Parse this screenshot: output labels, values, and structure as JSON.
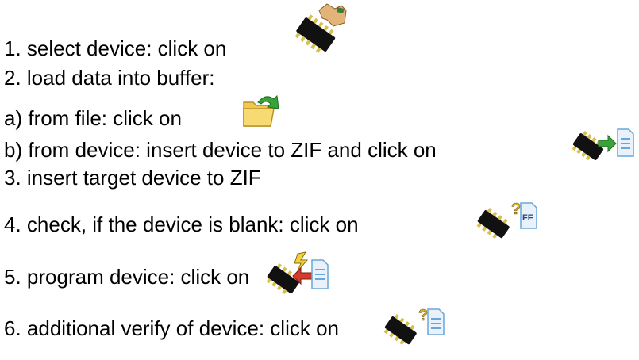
{
  "steps": [
    {
      "text": "1.  select device: click on",
      "icon": "select-device-icon"
    },
    {
      "text": "2.  load data into buffer:"
    },
    {
      "text": "a)  from file: click on",
      "icon": "open-file-icon"
    },
    {
      "text": "b)  from device: insert device to ZIF and click on",
      "icon": "read-device-icon"
    },
    {
      "text": "3.  insert target device to ZIF"
    },
    {
      "text": "4.  check, if the device is blank: click on",
      "icon": "blank-check-icon"
    },
    {
      "text": "5.  program device: click on",
      "icon": "program-device-icon"
    },
    {
      "text": "6.  additional verify of device: click on",
      "icon": "verify-device-icon"
    }
  ],
  "icon_labels": {
    "blank_check_text": "FF"
  },
  "colors": {
    "chip_body": "#111111",
    "chip_pins": "#d7bf4a",
    "folder": "#f1c84b",
    "arrow_green": "#3aa23a",
    "doc_blue": "#6aa7d8",
    "question_gold": "#d7b12a",
    "program_red": "#d63a2a"
  }
}
